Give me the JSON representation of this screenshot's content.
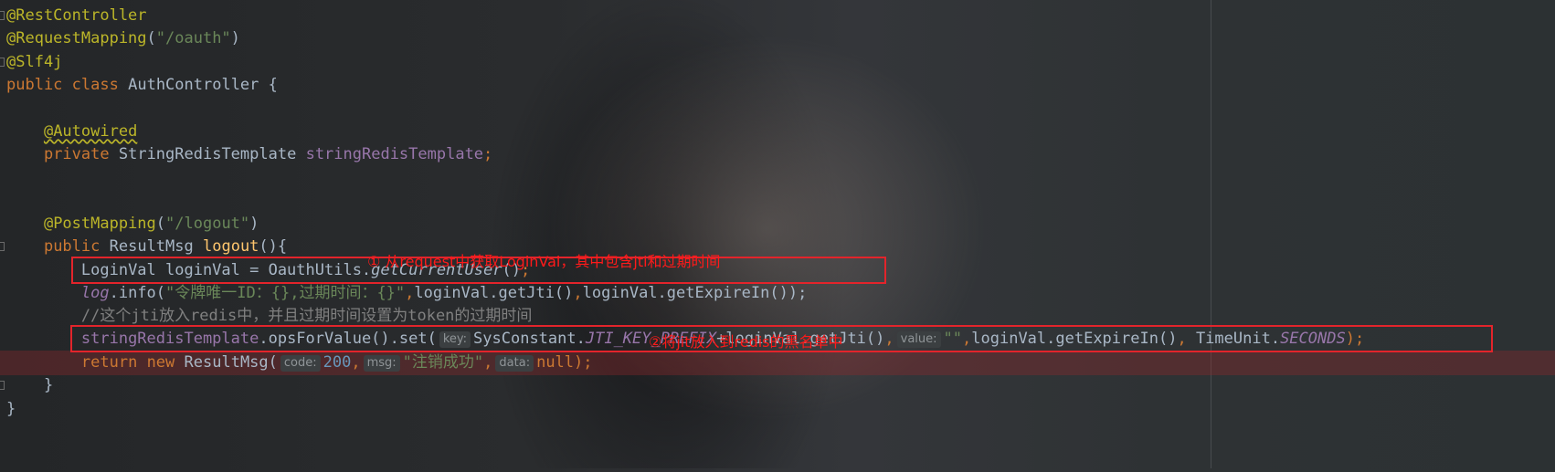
{
  "editor": {
    "lines": {
      "l1_annotation": "@RestController",
      "l2_annotation": "@RequestMapping",
      "l2_string": "\"/oauth\"",
      "l3_annotation": "@Slf4j",
      "l4_public": "public",
      "l4_class": "class",
      "l4_name": "AuthController {",
      "l6_annotation": "@Autowired",
      "l7_private": "private",
      "l7_type": "StringRedisTemplate",
      "l7_field": "stringRedisTemplate",
      "l10_annotation": "@PostMapping",
      "l10_string": "\"/logout\"",
      "l11_public": "public",
      "l11_type": "ResultMsg",
      "l11_method": "logout",
      "l11_rest": "(){",
      "l12_decl": "LoginVal loginVal = OauthUtils.",
      "l12_call": "getCurrentUser",
      "l12_end": "()",
      "l13_log": "log",
      "l13_info": ".info(",
      "l13_string": "\"令牌唯一ID：{},过期时间：{}\"",
      "l13_args1": "loginVal.getJti()",
      "l13_args2": "loginVal.getExpireIn()",
      "l13_end": ");",
      "l14_comment": "//这个jti放入redis中，并且过期时间设置为token的过期时间",
      "l15_field": "stringRedisTemplate",
      "l15_call": ".opsForValue().set(",
      "l15_hint_key": "key:",
      "l15_const_class": "SysConstant.",
      "l15_const": "JTI_KEY_PREFIX",
      "l15_concat": "+loginVal.getJti()",
      "l15_hint_value": "value:",
      "l15_empty_str": "\"\"",
      "l15_expire": "loginVal.getExpireIn()",
      "l15_unit_class": "TimeUnit.",
      "l15_unit": "SECONDS",
      "l15_end": ");",
      "l16_return": "return",
      "l16_new": "new",
      "l16_type": "ResultMsg(",
      "l16_hint_code": "code:",
      "l16_code": "200",
      "l16_hint_msg": "msg:",
      "l16_msg": "\"注销成功\"",
      "l16_hint_data": "data:",
      "l16_null": "null",
      "l16_end": ");",
      "l17_brace": "}",
      "l18_brace": "}"
    }
  },
  "annotations": {
    "note1": "① 从request中获取LoginVal，其中包含jti和过期时间",
    "note2": "②将jit放入到redis的黑名单中"
  },
  "colors": {
    "keyword": "#cc7832",
    "annotation": "#bbb529",
    "string": "#6a8759",
    "number": "#6897bb",
    "field": "#9876aa",
    "method_decl": "#ffc66d",
    "comment": "#808080",
    "text": "#a9b7c6",
    "highlight_box": "#e3242b"
  }
}
